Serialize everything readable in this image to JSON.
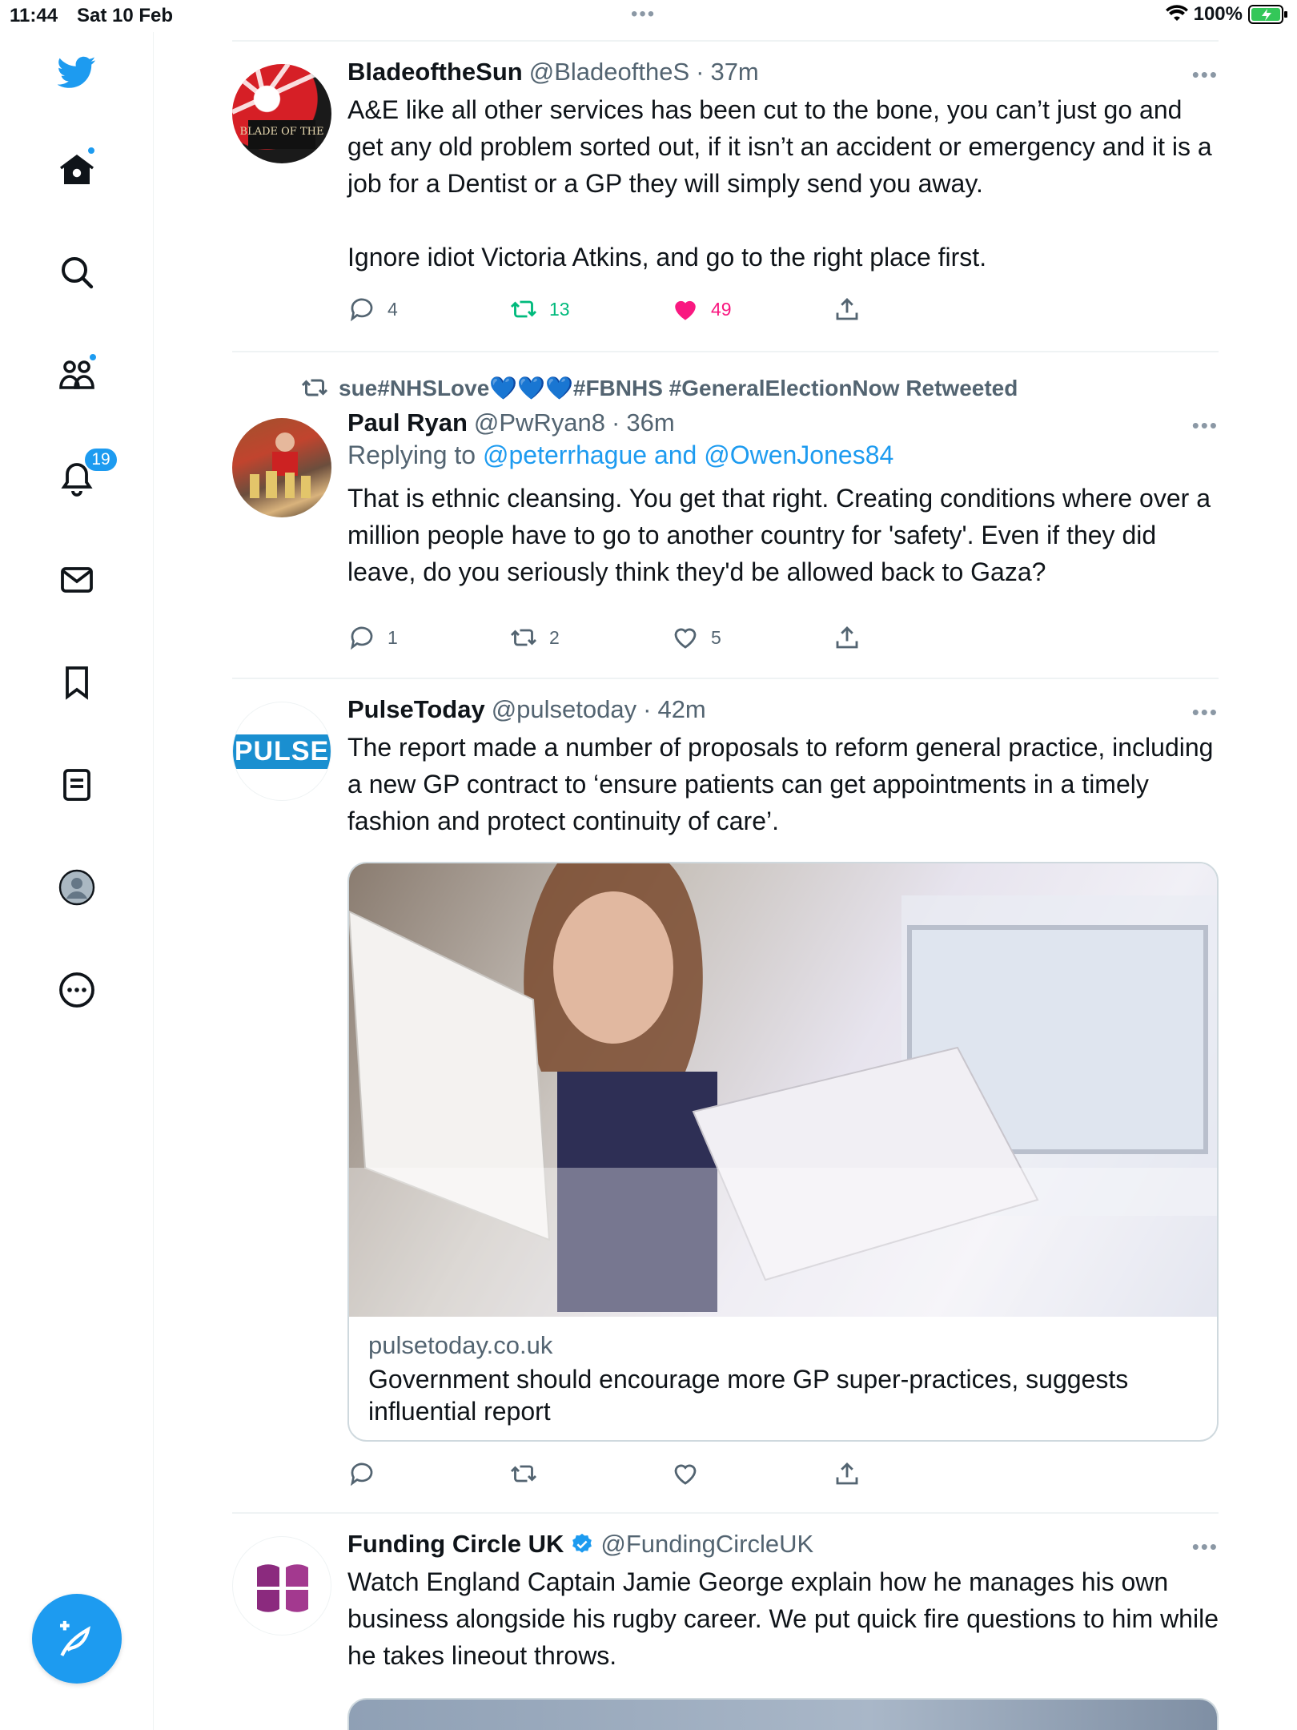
{
  "status_bar": {
    "time": "11:44",
    "date": "Sat 10 Feb",
    "battery": "100%"
  },
  "sidebar": {
    "notifications_badge": "19"
  },
  "tweets": [
    {
      "name": "BladeoftheSun",
      "handle": "@BladeoftheS",
      "time": "37m",
      "text": "A&E like all other services has been cut to the bone, you can’t just go and get any old problem sorted out, if it isn’t an accident or emergency and it is a job for a Dentist or a GP they will simply send you away.\n\nIgnore idiot Victoria Atkins, and go to the right place first.",
      "replies": "4",
      "retweets": "13",
      "likes": "49",
      "avatar_text": "BLADE OF THE"
    },
    {
      "retweeted_by": "sue#NHSLove💙💙💙#FBNHS #GeneralElectionNow Retweeted",
      "name": "Paul Ryan",
      "handle": "@PwRyan8",
      "time": "36m",
      "replying_prefix": "Replying to",
      "replying_to": "@peterrhague and @OwenJones84",
      "text": "That is ethnic cleansing. You get that right. Creating conditions where over a million people have to go to another country for 'safety'. Even if they did leave, do you seriously think they'd be allowed back to Gaza?",
      "replies": "1",
      "retweets": "2",
      "likes": "5"
    },
    {
      "name": "PulseToday",
      "handle": "@pulsetoday",
      "time": "42m",
      "avatar_text": "PULSE",
      "text": "The report made a number of proposals to reform general practice, including a new GP contract to ‘ensure patients can get appointments in a timely fashion and protect continuity of care’.",
      "card_domain": "pulsetoday.co.uk",
      "card_title": "Government should encourage more GP super-practices, suggests influential report"
    },
    {
      "name": "Funding Circle UK",
      "handle": "@FundingCircleUK",
      "text": "Watch England Captain Jamie George explain how he manages his own business alongside his rugby career. We put quick fire questions to him while he takes lineout throws."
    }
  ],
  "colors": {
    "accent": "#1d9bf0",
    "like": "#f91880",
    "retweet": "#00ba7c",
    "muted": "#536471"
  }
}
